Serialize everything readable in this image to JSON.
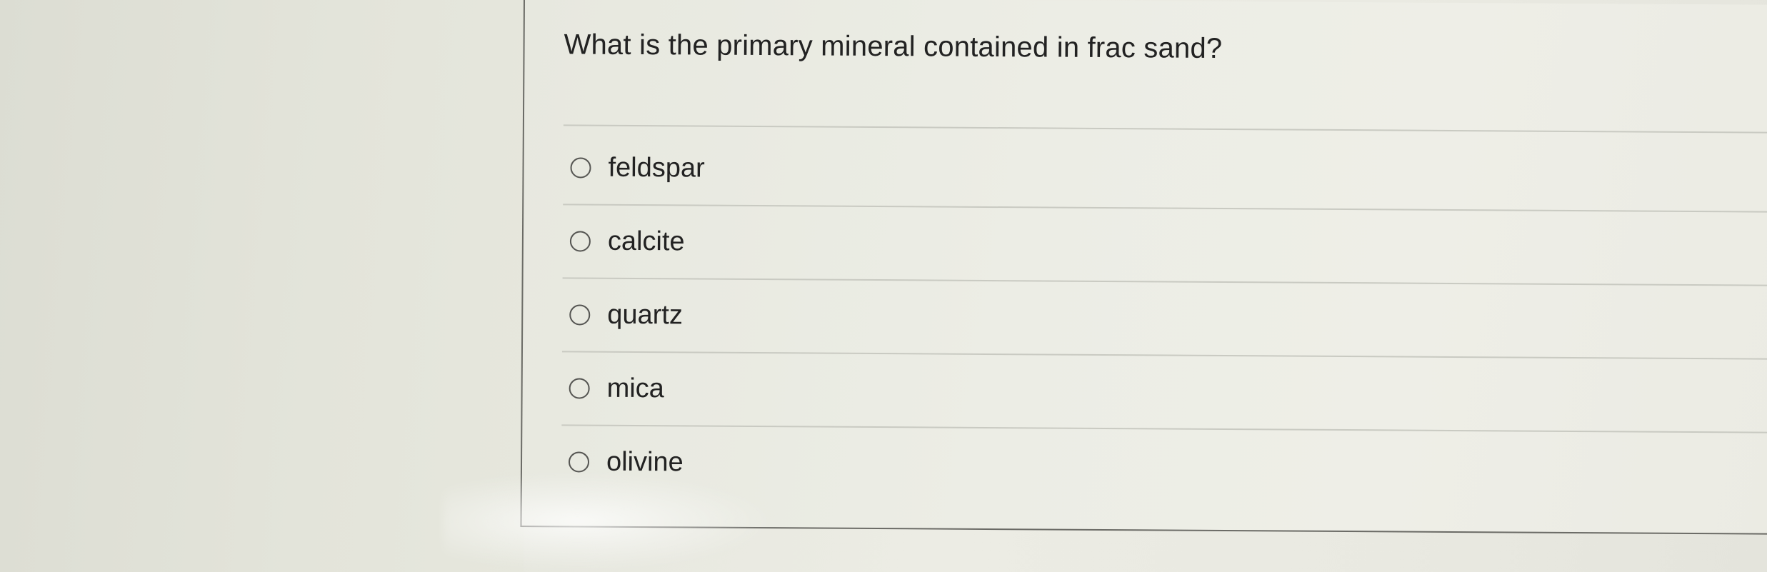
{
  "question": {
    "text": "What is the primary mineral contained in frac sand?"
  },
  "options": [
    {
      "label": "feldspar",
      "selected": false,
      "icon": "radio-unselected-icon"
    },
    {
      "label": "calcite",
      "selected": false,
      "icon": "radio-unselected-icon"
    },
    {
      "label": "quartz",
      "selected": false,
      "icon": "radio-unselected-icon"
    },
    {
      "label": "mica",
      "selected": false,
      "icon": "radio-unselected-icon"
    },
    {
      "label": "olivine",
      "selected": false,
      "icon": "radio-unselected-icon"
    }
  ],
  "colors": {
    "text": "#222222",
    "divider": "#c9cac2",
    "panel_border": "#6b6b66",
    "background": "#e8e9e0"
  }
}
